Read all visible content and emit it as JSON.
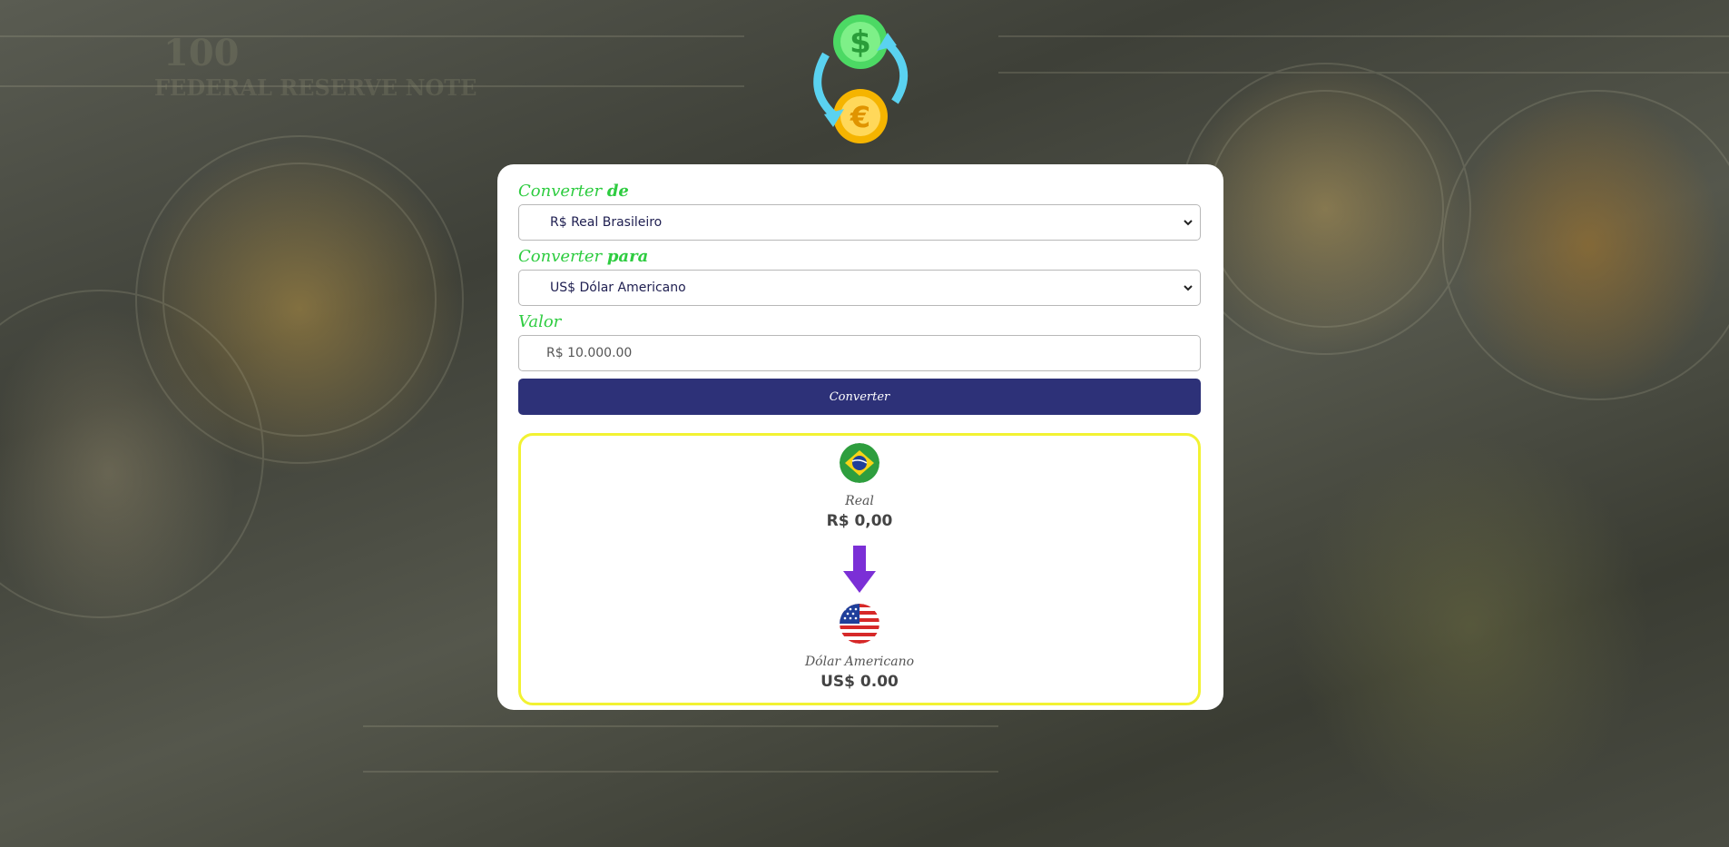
{
  "form": {
    "from_label_prefix": "Converter ",
    "from_label_bold": "de",
    "from_selected": "R$ Real Brasileiro",
    "to_label_prefix": "Converter ",
    "to_label_bold": "para",
    "to_selected": "US$ Dólar Americano",
    "value_label": "Valor",
    "value_placeholder": "R$ 10.000.00",
    "convert_button": "Converter"
  },
  "result": {
    "from_currency_name": "Real",
    "from_currency_value": "R$ 0,00",
    "to_currency_name": "Dólar Americano",
    "to_currency_value": "US$ 0.00"
  },
  "colors": {
    "label_green": "#2ecc40",
    "button_navy": "#2d3178",
    "result_border_yellow": "#f2f232",
    "arrow_purple": "#7b2fd6"
  },
  "icons": {
    "logo": "currency-exchange-icon",
    "from_flag": "brazil-flag-icon",
    "to_flag": "usa-flag-icon",
    "arrow": "arrow-down-icon"
  }
}
